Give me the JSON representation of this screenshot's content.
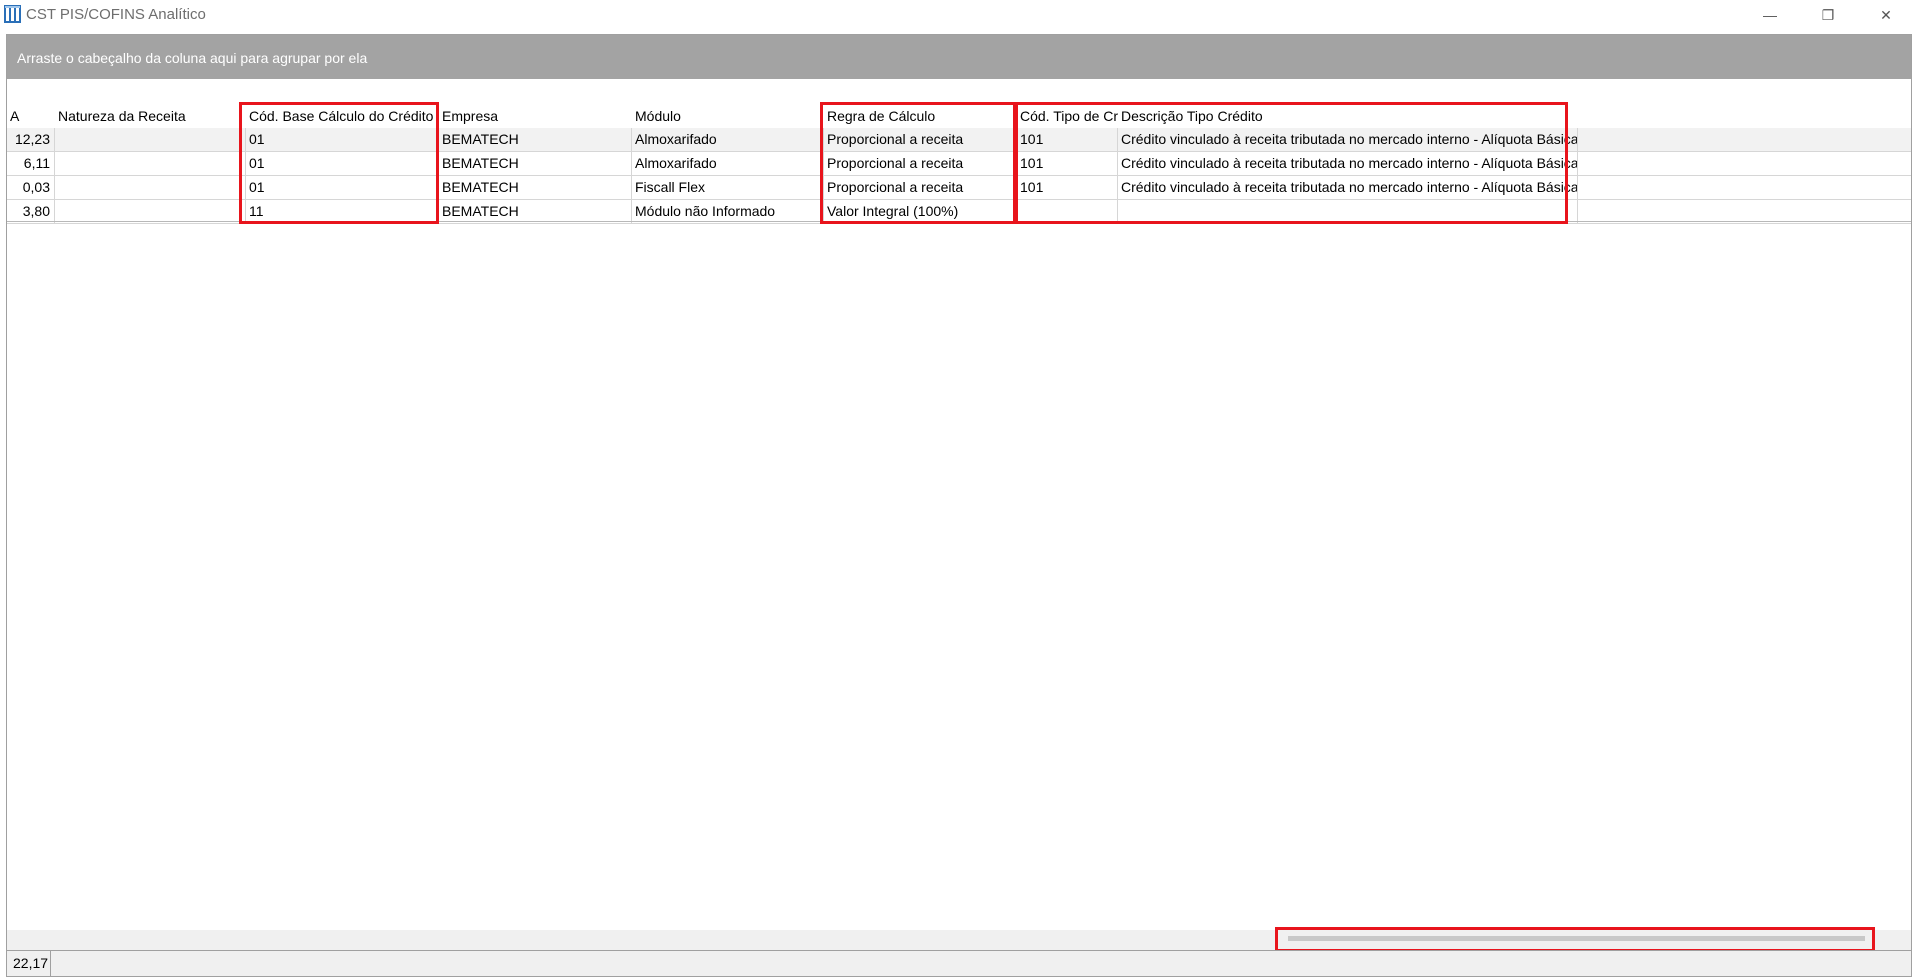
{
  "window": {
    "title": "CST PIS/COFINS Analítico",
    "minimize_glyph": "—",
    "maximize_glyph": "❐",
    "close_glyph": "✕"
  },
  "group_panel": {
    "text": "Arraste o cabeçalho da coluna aqui para agrupar por ela"
  },
  "grid": {
    "columns": [
      "A",
      "Natureza da Receita",
      "Cód. Base Cálculo do Crédito",
      "Empresa",
      "Módulo",
      "Regra de Cálculo",
      "Cód. Tipo de Cre",
      "Descrição Tipo Crédito"
    ],
    "rows": [
      [
        "12,23",
        "",
        "01",
        "BEMATECH",
        "Almoxarifado",
        "Proporcional a receita",
        "101",
        "Crédito vinculado à receita tributada no mercado interno - Alíquota Básica"
      ],
      [
        "6,11",
        "",
        "01",
        "BEMATECH",
        "Almoxarifado",
        "Proporcional a receita",
        "101",
        "Crédito vinculado à receita tributada no mercado interno - Alíquota Básica"
      ],
      [
        "0,03",
        "",
        "01",
        "BEMATECH",
        "Fiscall Flex",
        "Proporcional a receita",
        "101",
        "Crédito vinculado à receita tributada no mercado interno - Alíquota Básica"
      ],
      [
        "3,80",
        "",
        "11",
        "BEMATECH",
        "Módulo não Informado",
        "Valor Integral (100%)",
        "",
        ""
      ]
    ]
  },
  "footer": {
    "total": "22,17"
  },
  "colors": {
    "highlight": "#e8141c",
    "group_panel": "#a3a3a3"
  }
}
